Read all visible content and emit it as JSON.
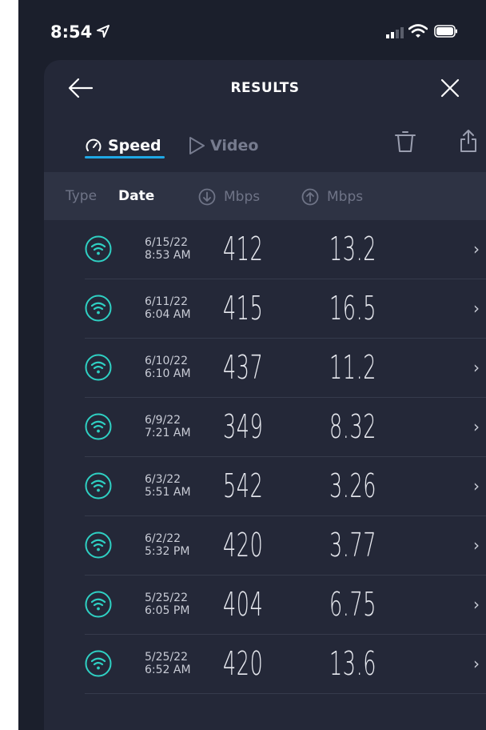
{
  "status_bar": {
    "time": "8:54",
    "icons": [
      "location-arrow-icon",
      "signal-icon",
      "wifi-icon",
      "battery-icon"
    ]
  },
  "nav": {
    "title": "RESULTS",
    "back_icon": "arrow-left-icon",
    "close_icon": "close-icon"
  },
  "tabs": [
    {
      "label": "Speed",
      "icon": "gauge-icon",
      "selected": true
    },
    {
      "label": "Video",
      "icon": "play-icon",
      "selected": false
    }
  ],
  "toolbar": {
    "delete_icon": "trash-icon",
    "share_icon": "share-icon"
  },
  "table": {
    "headers": {
      "type": "Type",
      "date": "Date",
      "download": "Mbps",
      "upload": "Mbps"
    },
    "rows": [
      {
        "date": "6/15/22",
        "time": "8:53 AM",
        "download": "412",
        "upload": "13.2"
      },
      {
        "date": "6/11/22",
        "time": "6:04 AM",
        "download": "415",
        "upload": "16.5"
      },
      {
        "date": "6/10/22",
        "time": "6:10 AM",
        "download": "437",
        "upload": "11.2"
      },
      {
        "date": "6/9/22",
        "time": "7:21 AM",
        "download": "349",
        "upload": "8.32"
      },
      {
        "date": "6/3/22",
        "time": "5:51 AM",
        "download": "542",
        "upload": "3.26"
      },
      {
        "date": "6/2/22",
        "time": "5:32 PM",
        "download": "420",
        "upload": "3.77"
      },
      {
        "date": "5/25/22",
        "time": "6:05 PM",
        "download": "404",
        "upload": "6.75"
      },
      {
        "date": "5/25/22",
        "time": "6:52 AM",
        "download": "420",
        "upload": "13.6"
      }
    ]
  },
  "colors": {
    "background": "#1b1f2c",
    "sheet": "#242838",
    "header_row": "#2e3344",
    "accent_blue": "#1fa8e6",
    "wifi_teal": "#2fd0c3"
  }
}
